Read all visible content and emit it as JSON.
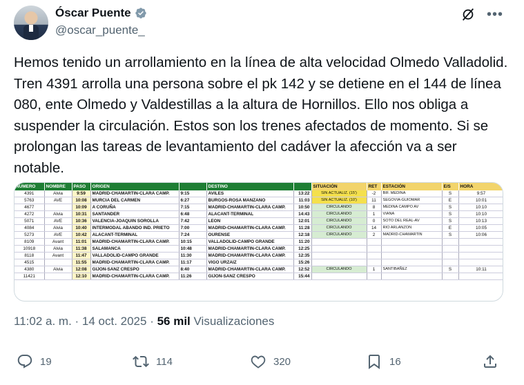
{
  "author": {
    "name": "Óscar Puente",
    "handle": "@oscar_puente_"
  },
  "tweet": {
    "text": "Hemos tenido un arrollamiento en la línea de alta velocidad Olmedo Valladolid. Tren 4391 arrolla una persona sobre el pk 142 y se detiene en el 144 de línea 080, ente Olmedo y Valdestillas  a la altura de Hornillos. Ello nos obliga a suspender la circulación. Estos son los trenes afectados de momento. Si se prolongan las tareas de levantamiento del cadáver la afección va a ser notable."
  },
  "table": {
    "headers": [
      "NUMERO",
      "NOMBRE",
      "PASO",
      "ORIGEN",
      "",
      "DESTINO",
      "",
      "SITUACIÓN",
      "RET",
      "ESTACIÓN",
      "E/S",
      "HORA"
    ],
    "rows": [
      [
        "4391",
        "Alvia",
        "9:59",
        "MADRID-CHAMARTIN-CLARA CAMP.",
        "9:15",
        "AVILES",
        "13:22",
        "SIN ACTUALIZ. (15')",
        "-2",
        "BIF. MEDINA",
        "S",
        "9:57"
      ],
      [
        "5763",
        "AVE",
        "10:08",
        "MURCIA DEL CARMEN",
        "6:27",
        "BURGOS-ROSA MANZANO",
        "11:03",
        "SIN ACTUALIZ. (10')",
        "11",
        "SEGOVIA-GUIOMAR",
        "E",
        "10:01"
      ],
      [
        "4677",
        "",
        "10:09",
        "A CORUÑA",
        "7:15",
        "MADRID-CHAMARTIN-CLARA CAMP.",
        "10:50",
        "CIRCULANDO",
        "8",
        "MEDINA CAMPO AV",
        "S",
        "10:10"
      ],
      [
        "4272",
        "Alvia",
        "10:31",
        "SANTANDER",
        "6:48",
        "ALACANT-TERMINAL",
        "14:43",
        "CIRCULANDO",
        "1",
        "VIANA",
        "S",
        "10:10"
      ],
      [
        "5071",
        "AVE",
        "10:36",
        "VALENCIA-JOAQUIN SOROLLA",
        "7:42",
        "LEON",
        "12:01",
        "CIRCULANDO",
        "0",
        "SOTO DEL REAL-AV",
        "S",
        "10:13"
      ],
      [
        "4084",
        "Alvia",
        "10:40",
        "INTERMODAL ABANDO IND. PRIETO",
        "7:00",
        "MADRID-CHAMARTIN-CLARA CAMP.",
        "11:28",
        "CIRCULANDO",
        "14",
        "RIO ARLANZON",
        "E",
        "10:05"
      ],
      [
        "5273",
        "AVE",
        "10:42",
        "ALACANT-TERMINAL",
        "7:24",
        "OURENSE",
        "12:18",
        "CIRCULANDO",
        "2",
        "MADRID-CHAMARTIN",
        "S",
        "10:06"
      ],
      [
        "8109",
        "Avant",
        "11:01",
        "MADRID-CHAMARTIN-CLARA CAMP.",
        "10:15",
        "VALLADOLID-CAMPO GRANDE",
        "11:20",
        "",
        "",
        "",
        "",
        ""
      ],
      [
        "10918",
        "Alvia",
        "11:38",
        "SALAMANCA",
        "10:48",
        "MADRID-CHAMARTIN-CLARA CAMP.",
        "12:25",
        "",
        "",
        "",
        "",
        ""
      ],
      [
        "8118",
        "Avant",
        "11:47",
        "VALLADOLID-CAMPO GRANDE",
        "11:30",
        "MADRID-CHAMARTIN-CLARA CAMP.",
        "12:35",
        "",
        "",
        "",
        "",
        ""
      ],
      [
        "4515",
        "",
        "11:55",
        "MADRID-CHAMARTIN-CLARA CAMP.",
        "11:17",
        "VIGO URZAIZ",
        "15:26",
        "",
        "",
        "",
        "",
        ""
      ],
      [
        "4380",
        "Alvia",
        "12:08",
        "GIJON-SANZ CRESPO",
        "8:40",
        "MADRID-CHAMARTIN-CLARA CAMP.",
        "12:52",
        "CIRCULANDO",
        "1",
        "SANTIBAÑEZ",
        "S",
        "10:11"
      ],
      [
        "11421",
        "",
        "12:10",
        "MADRID-CHAMARTIN-CLARA CAMP.",
        "11:26",
        "GIJON-SANZ CRESPO",
        "15:44",
        "",
        "",
        "",
        "",
        ""
      ]
    ]
  },
  "meta": {
    "time": "11:02 a. m. · 14 oct. 2025 · ",
    "views_count": "56 mil",
    "views_label": " Visualizaciones"
  },
  "actions": {
    "replies": "19",
    "reposts": "114",
    "likes": "320",
    "bookmarks": "16"
  },
  "colors": {
    "header_green": "#1e7e34",
    "header_yellow": "#f2d46b",
    "status_green": "#d6ecd2",
    "status_yellow": "#f4e04d",
    "verified_gray": "#829aab"
  }
}
